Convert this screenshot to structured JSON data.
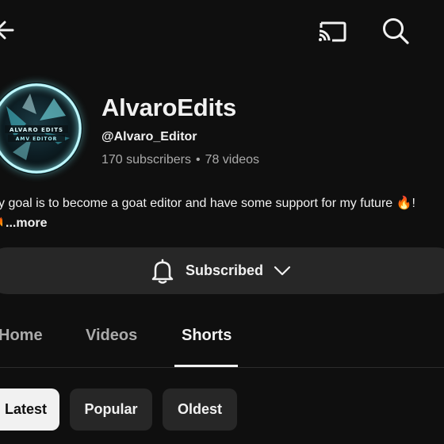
{
  "channel": {
    "name": "AlvaroEdits",
    "handle": "@Alvaro_Editor",
    "subscribers": "170 subscribers",
    "separator": "•",
    "videos": "78 videos",
    "avatar_text": "ALVARO EDITS"
  },
  "description": {
    "text": "y goal is to become a goat editor and have some support for my future 🔥!",
    "leading_emoji": "🔥",
    "more_label": "...more"
  },
  "subscribe_button": {
    "label": "Subscribed"
  },
  "tabs": [
    {
      "label": "Home",
      "selected": false
    },
    {
      "label": "Videos",
      "selected": false
    },
    {
      "label": "Shorts",
      "selected": true
    }
  ],
  "sort_chips": [
    {
      "label": "Latest",
      "selected": true
    },
    {
      "label": "Popular",
      "selected": false
    },
    {
      "label": "Oldest",
      "selected": false
    }
  ],
  "icons": {
    "back": "back-arrow-icon",
    "cast": "cast-icon",
    "search": "search-icon",
    "bell": "bell-icon",
    "chevron": "chevron-down-icon"
  },
  "colors": {
    "background": "#0f0f0f",
    "text_primary": "#f1f1f1",
    "text_secondary": "#aaaaaa",
    "button_surface": "#272727",
    "selected_chip": "#f1f1f1"
  }
}
